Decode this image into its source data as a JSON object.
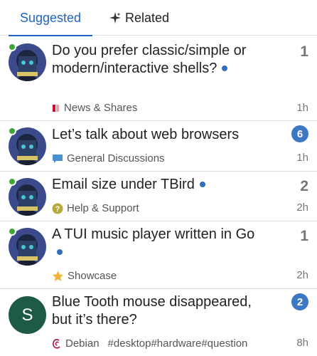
{
  "tabs": [
    {
      "label": "Suggested",
      "active": true
    },
    {
      "label": "Related",
      "icon": "sparkle-icon"
    }
  ],
  "topics": [
    {
      "title": "Do you prefer classic/simple or modern/interactive shells?",
      "new": true,
      "category": "News & Shares",
      "category_icon": "flag-icon",
      "category_color": "#c8102e",
      "replies": "1",
      "replies_badge": false,
      "age": "1h",
      "avatar": "anime-avatar",
      "online": true
    },
    {
      "title": "Let’s talk about web browsers",
      "new": false,
      "category": "General Discussions",
      "category_icon": "speech-bubble-icon",
      "category_color": "#4b8fd1",
      "replies": "6",
      "replies_badge": true,
      "age": "1h",
      "avatar": "anime-avatar",
      "online": true
    },
    {
      "title": "Email size under TBird",
      "new": true,
      "category": "Help & Support",
      "category_icon": "question-circle-icon",
      "category_color": "#b7a93a",
      "replies": "2",
      "replies_badge": false,
      "age": "2h",
      "avatar": "anime-avatar",
      "online": true
    },
    {
      "title": "A TUI music player written in Go",
      "new": true,
      "category": "Showcase",
      "category_icon": "star-icon",
      "category_color": "#f2b338",
      "replies": "1",
      "replies_badge": false,
      "age": "2h",
      "avatar": "anime-avatar",
      "online": true
    },
    {
      "title": "Blue Tooth mouse disappeared, but it’s there?",
      "new": false,
      "category": "Debian",
      "category_icon": "debian-swirl-icon",
      "category_color": "#a80030",
      "tags": [
        "#desktop",
        "#hardware",
        "#question"
      ],
      "replies": "2",
      "replies_badge": true,
      "age": "8h",
      "avatar_letter": "S",
      "avatar_color": "#1e5b45",
      "online": false
    }
  ]
}
